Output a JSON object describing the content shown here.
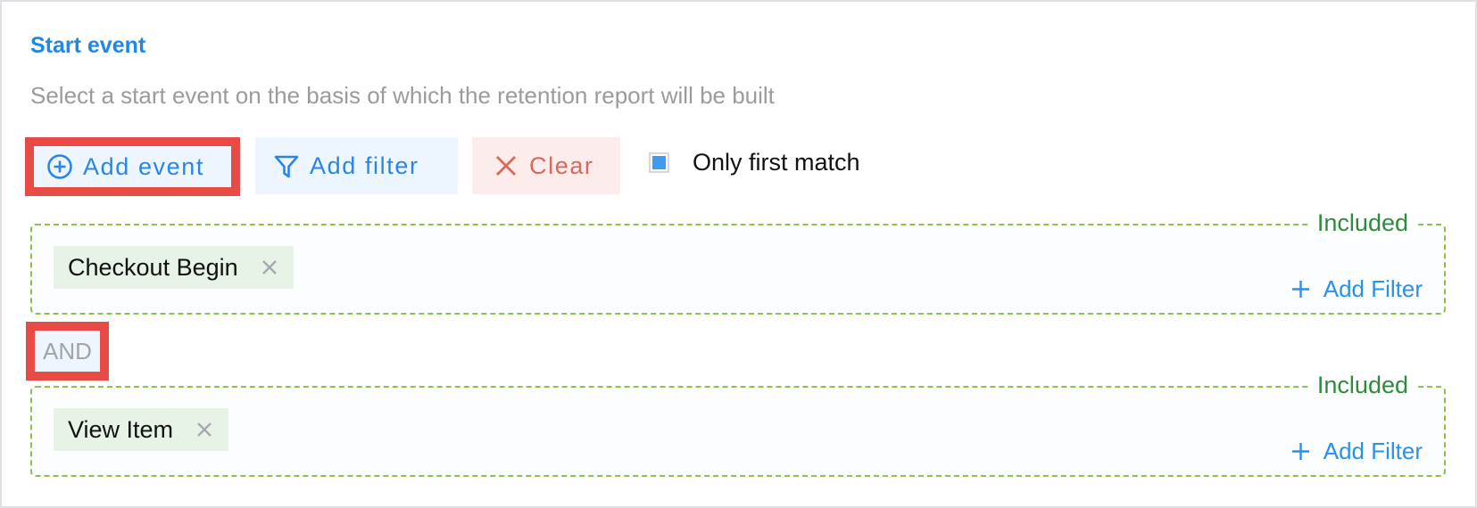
{
  "section": {
    "title": "Start event",
    "description": "Select a start event on the basis of which the retention report will be built"
  },
  "toolbar": {
    "add_event": {
      "label": "Add event",
      "icon": "plus-circle-icon",
      "highlighted": true
    },
    "add_filter": {
      "label": "Add filter",
      "icon": "funnel-icon"
    },
    "clear": {
      "label": "Clear",
      "icon": "close-icon"
    },
    "only_first_match": {
      "label": "Only first match",
      "checked": true
    }
  },
  "groups": [
    {
      "tag": "Included",
      "events": [
        {
          "label": "Checkout Begin",
          "remove_icon": "close-icon"
        }
      ],
      "add_filter_label": "Add Filter"
    },
    {
      "tag": "Included",
      "events": [
        {
          "label": "View Item",
          "remove_icon": "close-icon"
        }
      ],
      "add_filter_label": "Add Filter"
    }
  ],
  "connector": {
    "label": "AND",
    "highlighted": true
  },
  "colors": {
    "accent": "#2a86e6",
    "title": "#1f86ea",
    "clear": "#d9685b",
    "included": "#2e8b3e",
    "dashed_border": "#8bc34a",
    "highlight": "#e84a45",
    "checkbox": "#3d9bf0"
  }
}
